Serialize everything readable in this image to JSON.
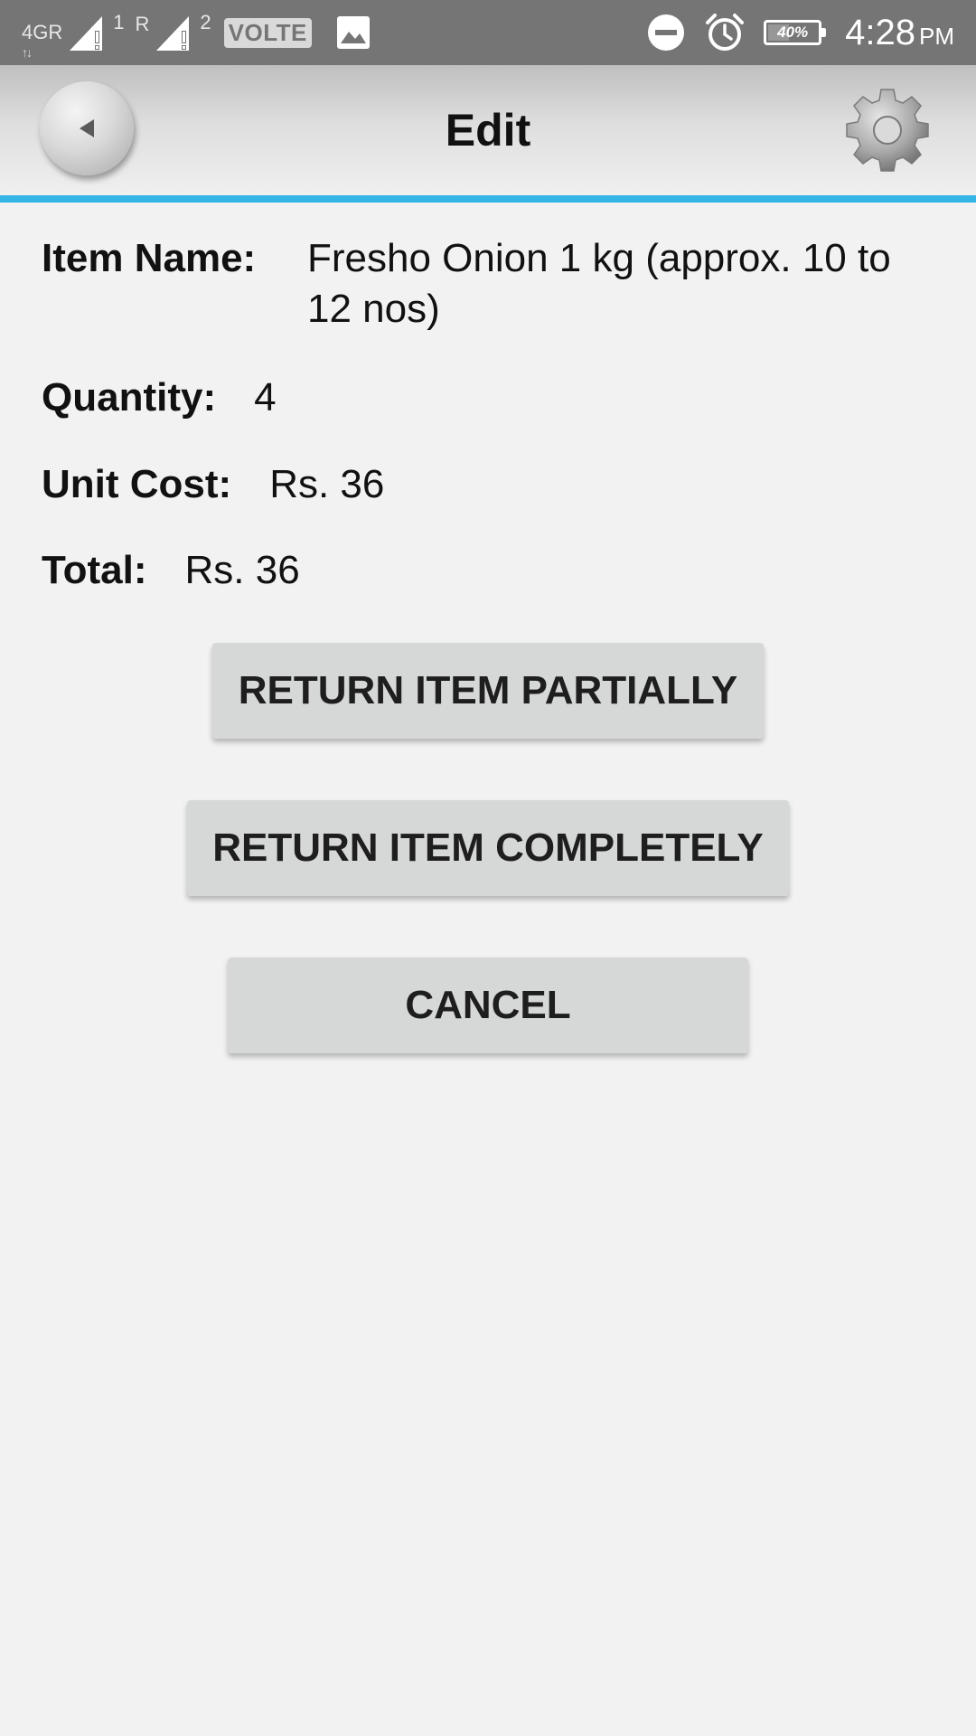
{
  "status_bar": {
    "network_label": "4G",
    "network_suffix": "R",
    "network_arrows": "↑↓",
    "sim1_label": "1",
    "sim2_prefix": "R",
    "sim2_label": "2",
    "volte": "VOLTE",
    "battery_percent": "40%",
    "battery_level": 0.4,
    "time": "4:28",
    "ampm": "PM",
    "icons": [
      "signal-icon",
      "gallery-icon",
      "do-not-disturb-icon",
      "alarm-icon",
      "battery-icon"
    ]
  },
  "header": {
    "title": "Edit",
    "back_icon": "back-arrow-icon",
    "settings_icon": "gear-icon",
    "accent_color": "#33b5e5"
  },
  "details": {
    "item_name_label": "Item Name:",
    "item_name_value": "Fresho Onion 1 kg  (approx. 10 to 12 nos)",
    "quantity_label": "Quantity:",
    "quantity_value": "4",
    "unit_cost_label": "Unit Cost:",
    "unit_cost_value": "Rs. 36",
    "total_label": "Total:",
    "total_value": "Rs. 36"
  },
  "actions": {
    "return_partial": "RETURN ITEM PARTIALLY",
    "return_complete": "RETURN ITEM COMPLETELY",
    "cancel": "CANCEL"
  }
}
